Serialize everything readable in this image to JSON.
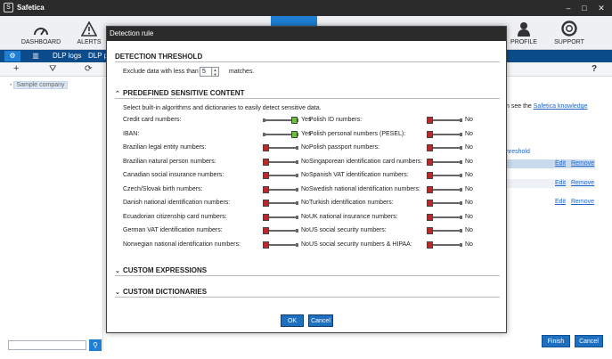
{
  "window": {
    "title": "Safetica"
  },
  "ribbon": {
    "items": [
      {
        "label": "DASHBOARD",
        "icon": "dashboard-icon"
      },
      {
        "label": "ALERTS",
        "icon": "alert-icon"
      },
      {
        "label": "PROFILE",
        "icon": "profile-icon"
      },
      {
        "label": "SUPPORT",
        "icon": "support-icon"
      }
    ]
  },
  "toolbar": {
    "tab1": "DLP logs",
    "tab2": "DLP p"
  },
  "sidebar": {
    "tree_item": "Sample company"
  },
  "background": {
    "knowledge_prefix": "n see the",
    "knowledge_link": "Safetica knowledge",
    "threshold_col": "hreshold",
    "edit": "Edit",
    "remove": "Remove",
    "finish": "Finish",
    "cancel": "Cancel",
    "help": "?"
  },
  "dialog": {
    "title": "Detection rule",
    "threshold": {
      "heading": "DETECTION THRESHOLD",
      "label_before": "Exclude data with less than",
      "value": "5",
      "label_after": "matches."
    },
    "predefined": {
      "heading": "PREDEFINED SENSITIVE CONTENT",
      "description": "Select built-in algorithms and dictionaries to easily detect sensitive data.",
      "left": [
        {
          "name": "Credit card numbers:",
          "state": "Yes"
        },
        {
          "name": "IBAN:",
          "state": "Yes"
        },
        {
          "name": "Brazilian legal entity numbers:",
          "state": "No"
        },
        {
          "name": "Brazilian natural person numbers:",
          "state": "No"
        },
        {
          "name": "Canadian social insurance numbers:",
          "state": "No"
        },
        {
          "name": "Czech/Slovak birth numbers:",
          "state": "No"
        },
        {
          "name": "Danish national identification numbers:",
          "state": "No"
        },
        {
          "name": "Ecuadorian citizenship card numbers:",
          "state": "No"
        },
        {
          "name": "German VAT identification numbers:",
          "state": "No"
        },
        {
          "name": "Norwegian national identification numbers:",
          "state": "No"
        }
      ],
      "right": [
        {
          "name": "Polish ID numbers:",
          "state": "No"
        },
        {
          "name": "Polish personal numbers (PESEL):",
          "state": "No"
        },
        {
          "name": "Polish passport numbers:",
          "state": "No"
        },
        {
          "name": "Singaporean identification card numbers:",
          "state": "No"
        },
        {
          "name": "Spanish VAT identification numbers:",
          "state": "No"
        },
        {
          "name": "Swedish national identification numbers:",
          "state": "No"
        },
        {
          "name": "Turkish identification numbers:",
          "state": "No"
        },
        {
          "name": "UK national insurance numbers:",
          "state": "No"
        },
        {
          "name": "US social security numbers:",
          "state": "No"
        },
        {
          "name": "US social security numbers & HIPAA:",
          "state": "No"
        }
      ]
    },
    "custom_expressions": {
      "heading": "CUSTOM EXPRESSIONS"
    },
    "custom_dictionaries": {
      "heading": "CUSTOM DICTIONARIES"
    },
    "ok_label": "OK",
    "cancel_label": "Cancel"
  },
  "colors": {
    "accent": "#1e7fd4",
    "toggle_on": "#6fbf3f",
    "toggle_off": "#b52a2a",
    "titlebar": "#2b2b2b"
  }
}
